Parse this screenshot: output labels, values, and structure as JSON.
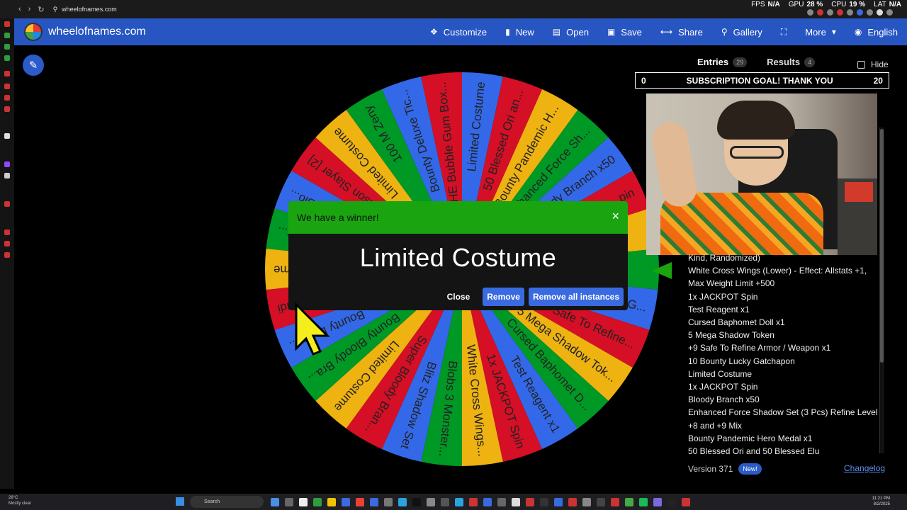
{
  "browser": {
    "url": "wheelofnames.com",
    "stats": [
      {
        "label": "FPS",
        "value": "N/A"
      },
      {
        "label": "GPU",
        "value": "28 %"
      },
      {
        "label": "CPU",
        "value": "19 %"
      },
      {
        "label": "LAT",
        "value": "N/A"
      }
    ]
  },
  "header": {
    "site_name": "wheelofnames.com",
    "menu": [
      {
        "label": "Customize",
        "icon": "palette-icon"
      },
      {
        "label": "New",
        "icon": "document-icon"
      },
      {
        "label": "Open",
        "icon": "folder-icon"
      },
      {
        "label": "Save",
        "icon": "save-icon"
      },
      {
        "label": "Share",
        "icon": "share-icon"
      },
      {
        "label": "Gallery",
        "icon": "search-icon"
      },
      {
        "label": "",
        "icon": "fullscreen-icon"
      },
      {
        "label": "More",
        "icon": "chevron-down-icon"
      },
      {
        "label": "English",
        "icon": "globe-icon"
      }
    ]
  },
  "wheel": {
    "colors": [
      "#3369e8",
      "#d50f25",
      "#eeb211",
      "#009925"
    ],
    "segments": [
      "Limited Costume",
      "50 Blessed Ori an...",
      "Bounty Pandemic H...",
      "Enhanced Force Sh...",
      "Bloody Branch x50",
      "...pin",
      "",
      "",
      "...G...",
      "+9 Safe To Refine...",
      "5 Mega Shadow Tok...",
      "Cursed Baphomet D...",
      "Test Reagent x1",
      "1x JACKPOT Spin",
      "White Cross Wings...",
      "Blobs 3 Monster...",
      "Blitz Shadow Set",
      "Super Bloody Bran...",
      "Limited Costume",
      "Bounty Bloody Bra...",
      "Bounty Letter...",
      "...udi",
      "...me",
      "1x...",
      "...Slo...",
      "Poison Slayer [2]",
      "Limited Costume",
      "100 M Zeny",
      "Bounty Deluxe Tic...",
      "HE Bubble Gum Box..."
    ]
  },
  "panel": {
    "tabs": [
      {
        "label": "Entries",
        "count": "29"
      },
      {
        "label": "Results",
        "count": "4"
      }
    ],
    "hide_label": "Hide",
    "goal": {
      "left": "0",
      "text": "SUBSCRIPTION GOAL! THANK YOU",
      "right": "20"
    },
    "entries": [
      "Kind, Randomized)",
      "White Cross Wings (Lower) - Effect: Allstats +1,",
      "Max Weight Limit +500",
      "1x JACKPOT Spin",
      "Test Reagent x1",
      "Cursed Baphomet Doll x1",
      "5 Mega Shadow Token",
      "+9 Safe To Refine Armor / Weapon x1",
      "10 Bounty Lucky Gatchapon",
      "Limited Costume",
      "1x JACKPOT Spin",
      "Bloody Branch x50",
      "Enhanced Force Shadow Set (3 Pcs) Refine Level",
      "+8 and +9 Mix",
      "Bounty Pandemic Hero Medal x1",
      "50 Blessed Ori and 50 Blessed Elu"
    ],
    "version": "Version 371",
    "new_badge": "New!",
    "changelog": "Changelog"
  },
  "modal": {
    "title": "We have a winner!",
    "winner": "Limited Costume",
    "close": "Close",
    "remove": "Remove",
    "remove_all": "Remove all instances"
  },
  "taskbar": {
    "weather_temp": "28°C",
    "weather_desc": "Mostly clear",
    "search": "Search",
    "time": "11:21 PM",
    "date": "8/2/2025"
  }
}
